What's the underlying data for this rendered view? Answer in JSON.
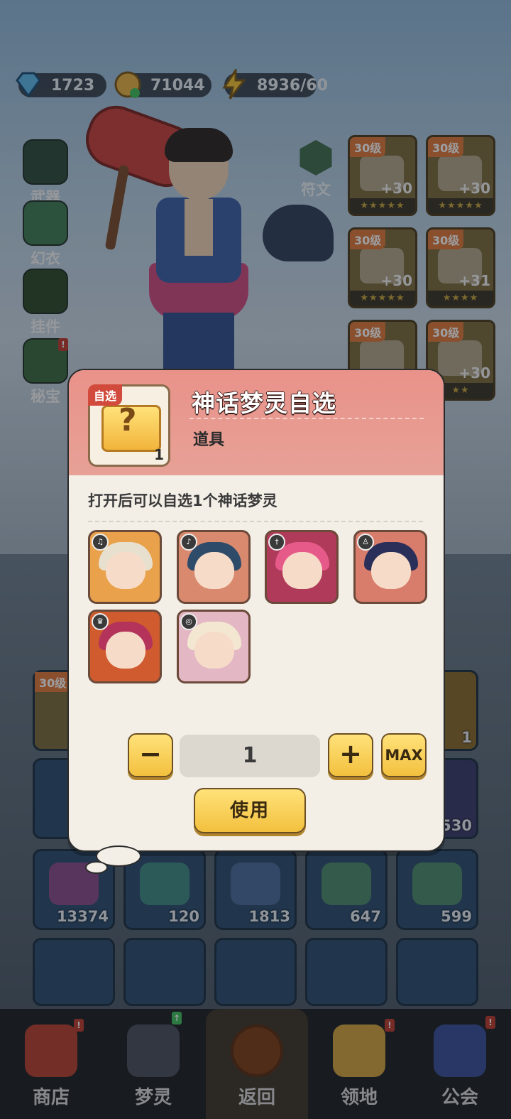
{
  "resources": {
    "diamond": "1723",
    "gold": "71044",
    "energy": "8936/60"
  },
  "side_menu": [
    {
      "label": "武器",
      "icon": "weapon-icon"
    },
    {
      "label": "幻衣",
      "icon": "shirt-icon"
    },
    {
      "label": "挂件",
      "icon": "pendant-icon"
    },
    {
      "label": "秘宝",
      "icon": "treasure-icon",
      "badge": "!"
    }
  ],
  "rune": {
    "label": "符文"
  },
  "equipment": [
    {
      "level": "30级",
      "bonus": "+30",
      "stars": "★★★★★"
    },
    {
      "level": "30级",
      "bonus": "+30",
      "stars": "★★★★★"
    },
    {
      "level": "30级",
      "bonus": "+30",
      "stars": "★★★★★"
    },
    {
      "level": "30级",
      "bonus": "+31",
      "stars": "★★★★"
    },
    {
      "level": "30级",
      "bonus": "",
      "stars": ""
    },
    {
      "level": "30级",
      "bonus": "+30",
      "stars": "★★"
    }
  ],
  "inventory_row_partial": [
    {
      "level": "30级",
      "count": ""
    },
    {
      "count": "1"
    },
    {
      "count": "530"
    }
  ],
  "inventory": [
    {
      "count": "13374"
    },
    {
      "count": "120"
    },
    {
      "count": "1813"
    },
    {
      "count": "647"
    },
    {
      "count": "599"
    }
  ],
  "popup": {
    "item_tag": "自选",
    "item_count": "1",
    "title": "神话梦灵自选",
    "type": "道具",
    "description": "打开后可以自选1个神话梦灵",
    "quantity": "1",
    "minus_label": "−",
    "plus_label": "+",
    "max_label": "MAX",
    "use_label": "使用",
    "spirits": [
      {
        "badge": "♫",
        "bg": "#e9a24b",
        "hair": "#e8e0cf"
      },
      {
        "badge": "♪",
        "bg": "#d98a6e",
        "hair": "#2f4b6a"
      },
      {
        "badge": "†",
        "bg": "#b03a5a",
        "hair": "#e65a8a"
      },
      {
        "badge": "♙",
        "bg": "#d87c6c",
        "hair": "#2a2f5a"
      },
      {
        "badge": "♛",
        "bg": "#cf5b2e",
        "hair": "#b3335a"
      },
      {
        "badge": "◎",
        "bg": "#e3b8c4",
        "hair": "#f4e7d2"
      }
    ]
  },
  "nav": [
    {
      "label": "商店",
      "icon": "shop-icon",
      "badge": "!"
    },
    {
      "label": "梦灵",
      "icon": "spirit-icon",
      "badge": "↑"
    },
    {
      "label": "返回",
      "icon": "back-icon"
    },
    {
      "label": "领地",
      "icon": "territory-icon",
      "badge": "!"
    },
    {
      "label": "公会",
      "icon": "guild-icon",
      "badge": "!"
    }
  ],
  "colors": {
    "popup_header": "#e9928a",
    "button_yellow": "#f3c03e",
    "popup_bg": "#f3eee6"
  }
}
